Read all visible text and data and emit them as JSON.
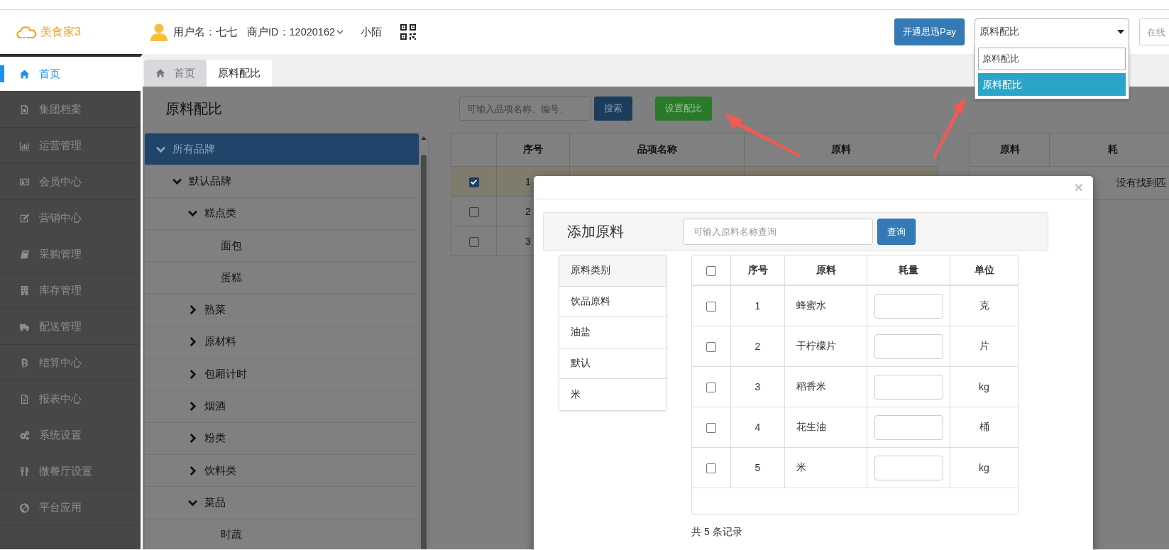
{
  "app": {
    "logo": "美食家3"
  },
  "header": {
    "username": "用户名：七七",
    "merchant_id": "商户ID：12020162",
    "store": "小陌",
    "pay_button": "开通思迅Pay",
    "page_select": {
      "value": "原料配比",
      "expanded": true,
      "search_value": "原料配比",
      "options": [
        {
          "label": "原料配比",
          "selected": true
        }
      ]
    },
    "help_field": {
      "placeholder": "在线"
    }
  },
  "sidebar": {
    "items": [
      {
        "label": "首页",
        "kind": "home",
        "selected": true
      },
      {
        "label": "集团档案",
        "kind": "file",
        "selected": false
      },
      {
        "label": "运营管理",
        "kind": "chart",
        "selected": false
      },
      {
        "label": "会员中心",
        "kind": "card",
        "selected": false
      },
      {
        "label": "营销中心",
        "kind": "edit",
        "selected": false
      },
      {
        "label": "采购管理",
        "kind": "book",
        "selected": false
      },
      {
        "label": "库存管理",
        "kind": "building",
        "selected": false
      },
      {
        "label": "配送管理",
        "kind": "truck",
        "selected": false
      },
      {
        "label": "结算中心",
        "kind": "coin",
        "selected": false
      },
      {
        "label": "报表中心",
        "kind": "doc",
        "selected": false
      },
      {
        "label": "系统设置",
        "kind": "gears",
        "selected": false
      },
      {
        "label": "微餐厅设置",
        "kind": "utensils",
        "selected": false
      },
      {
        "label": "平台应用",
        "kind": "badge",
        "selected": false
      }
    ]
  },
  "tabs": [
    {
      "label": "首页",
      "kind": "home",
      "selected": false
    },
    {
      "label": "原料配比",
      "kind": "plain",
      "selected": true
    }
  ],
  "page": {
    "title": "原料配比",
    "search": {
      "placeholder": "可输入品项名称、编号、"
    },
    "search_button": "搜索",
    "set_button": "设置配比"
  },
  "tree": [
    {
      "label": "所有品牌",
      "expanded": true,
      "selected": true,
      "children": [
        {
          "label": "默认品牌",
          "expanded": true,
          "selected": false,
          "children": [
            {
              "label": "糕点类",
              "expanded": true,
              "selected": false,
              "children": [
                {
                  "label": "面包",
                  "selected": false
                },
                {
                  "label": "蛋糕",
                  "selected": false
                }
              ]
            },
            {
              "label": "熟菜",
              "expanded": false,
              "selected": false
            },
            {
              "label": "原材料",
              "expanded": false,
              "selected": false
            },
            {
              "label": "包厢计时",
              "expanded": false,
              "selected": false
            },
            {
              "label": "烟酒",
              "expanded": false,
              "selected": false
            },
            {
              "label": "粉类",
              "expanded": false,
              "selected": false
            },
            {
              "label": "饮料类",
              "expanded": false,
              "selected": false
            },
            {
              "label": "菜品",
              "expanded": true,
              "selected": false,
              "children": [
                {
                  "label": "时蔬",
                  "selected": false
                }
              ]
            }
          ]
        }
      ]
    }
  ],
  "items_table": {
    "columns": [
      "序号",
      "品项名称",
      "原料"
    ],
    "rows": [
      {
        "seq": "1",
        "checked": true,
        "selected": true
      },
      {
        "seq": "2",
        "checked": false,
        "selected": false
      },
      {
        "seq": "3",
        "checked": false,
        "selected": false
      }
    ]
  },
  "materials_table": {
    "columns": [
      "原料",
      "耗"
    ],
    "empty_message": "没有找到匹"
  },
  "modal": {
    "close": "×",
    "title": "添加原料",
    "search": {
      "placeholder": "可输入原料名称查询"
    },
    "search_button": "查询",
    "categories": [
      {
        "label": "原料类别",
        "kind": "header"
      },
      {
        "label": "饮品原料",
        "kind": "item"
      },
      {
        "label": "油盐",
        "kind": "item"
      },
      {
        "label": "默认",
        "kind": "item"
      },
      {
        "label": "米",
        "kind": "item"
      }
    ],
    "table": {
      "all_checked": false,
      "columns": [
        "序号",
        "原料",
        "耗量",
        "单位"
      ],
      "rows": [
        {
          "seq": "1",
          "name": "蜂蜜水",
          "unit": "克",
          "checked": false
        },
        {
          "seq": "2",
          "name": "干柠檬片",
          "unit": "片",
          "checked": false
        },
        {
          "seq": "3",
          "name": "稻香米",
          "unit": "kg",
          "checked": false
        },
        {
          "seq": "4",
          "name": "花生油",
          "unit": "桶",
          "checked": false
        },
        {
          "seq": "5",
          "name": "米",
          "unit": "kg",
          "checked": false
        }
      ]
    },
    "footer": "共 5 条记录"
  }
}
